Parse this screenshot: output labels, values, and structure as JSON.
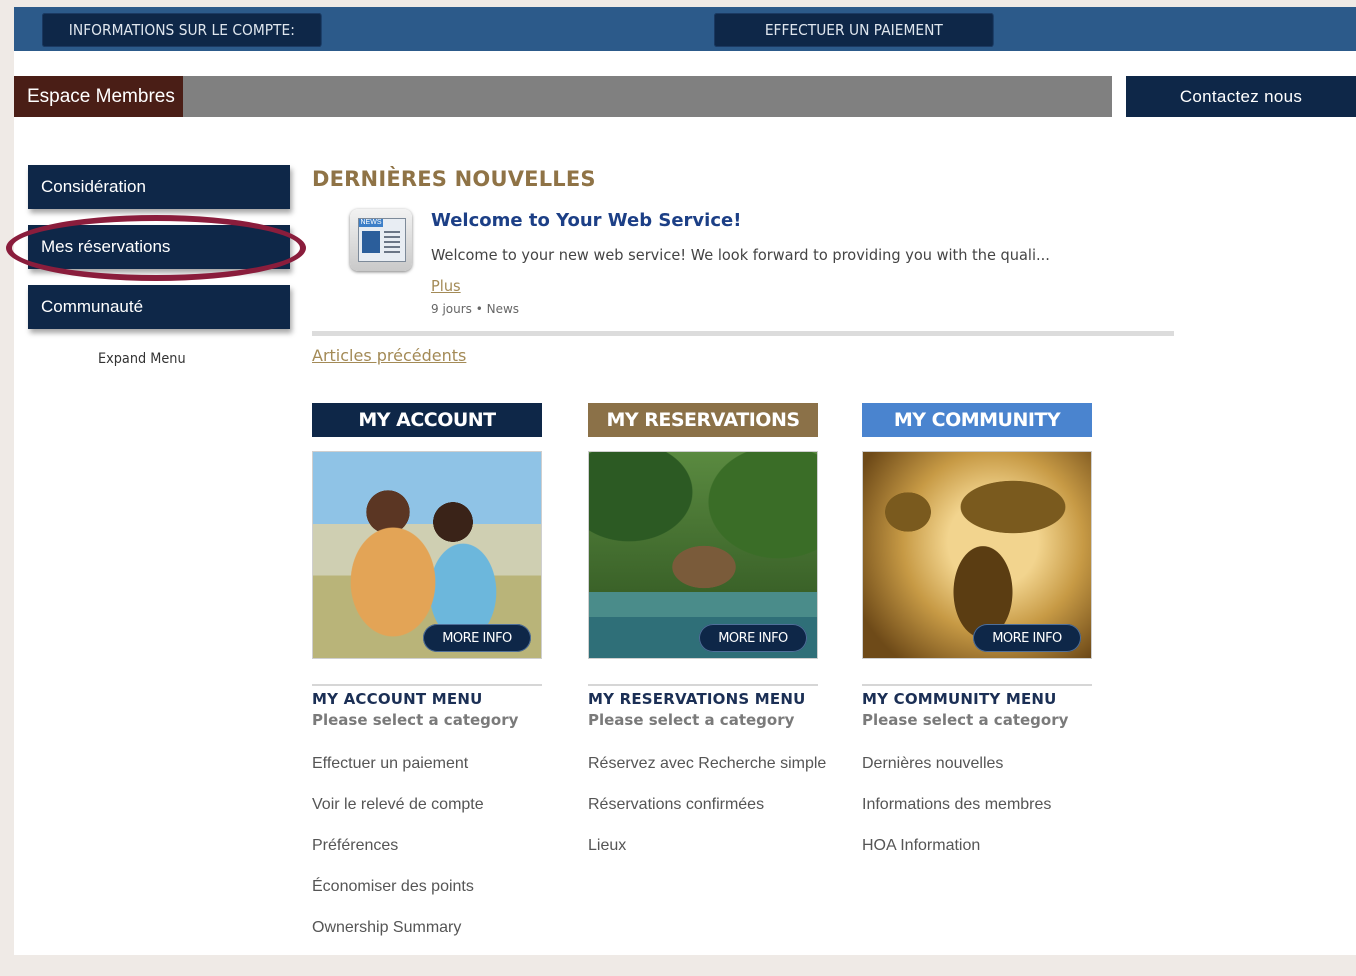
{
  "topnav": {
    "account_info": "INFORMATIONS SUR LE COMPTE:",
    "make_payment": "EFFECTUER UN PAIEMENT"
  },
  "memberbar": {
    "label": "Espace Membres",
    "contact": "Contactez nous"
  },
  "sidebar": {
    "items": [
      {
        "label": "Considération"
      },
      {
        "label": "Mes réservations",
        "highlighted": true
      },
      {
        "label": "Communauté"
      }
    ],
    "expand": "Expand Menu"
  },
  "news": {
    "title": "DERNIÈRES NOUVELLES",
    "icon_tag": "NEWS",
    "article": {
      "headline": "Welcome to Your Web Service!",
      "excerpt": "Welcome to your new web service! We look forward to providing you with the quali...",
      "more": "Plus",
      "meta": "9 jours • News"
    },
    "previous": "Articles précédents"
  },
  "cards": [
    {
      "title": "MY ACCOUNT",
      "more": "MORE INFO",
      "menu_title": "MY ACCOUNT MENU",
      "menu_sub": "Please select a category",
      "links": [
        "Effectuer un paiement",
        "Voir le relevé de compte",
        "Préférences",
        "Économiser des points",
        "Ownership Summary"
      ]
    },
    {
      "title": "MY RESERVATIONS",
      "more": "MORE INFO",
      "menu_title": "MY RESERVATIONS MENU",
      "menu_sub": "Please select a category",
      "links": [
        "Réservez avec Recherche simple",
        "Réservations confirmées",
        "Lieux"
      ]
    },
    {
      "title": "MY COMMUNITY",
      "more": "MORE INFO",
      "menu_title": "MY COMMUNITY MENU",
      "menu_sub": "Please select a category",
      "links": [
        "Dernières nouvelles",
        "Informations des membres",
        "HOA Information"
      ]
    }
  ],
  "colors": {
    "navy": "#0e2748",
    "topbar_blue": "#2c5a8a",
    "gold": "#8f7346",
    "community_blue": "#4a84cf",
    "highlight_ring": "#8a1d3c"
  }
}
